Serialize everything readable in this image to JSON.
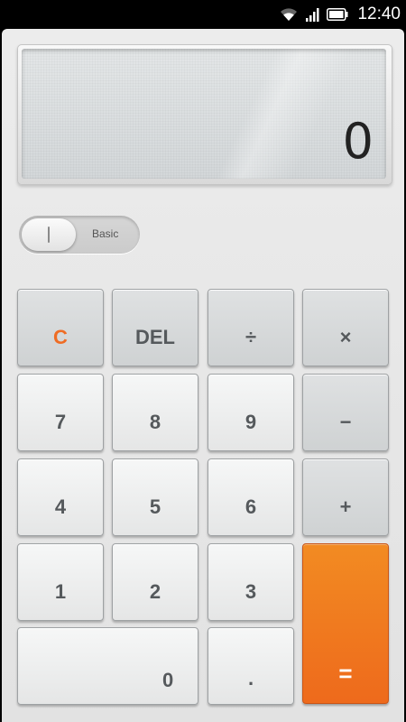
{
  "status_bar": {
    "time": "12:40"
  },
  "display": {
    "value": "0"
  },
  "mode_toggle": {
    "label": "Basic"
  },
  "keys": {
    "clear": "C",
    "delete": "DEL",
    "divide": "÷",
    "multiply": "×",
    "seven": "7",
    "eight": "8",
    "nine": "9",
    "minus": "−",
    "four": "4",
    "five": "5",
    "six": "6",
    "plus": "+",
    "one": "1",
    "two": "2",
    "three": "3",
    "zero": "0",
    "dot": ".",
    "equals": "="
  },
  "colors": {
    "accent": "#ef6c24",
    "equals_top": "#f28b22",
    "equals_bottom": "#ee6a1c"
  },
  "icons": [
    "wifi-icon",
    "signal-icon",
    "battery-icon"
  ]
}
